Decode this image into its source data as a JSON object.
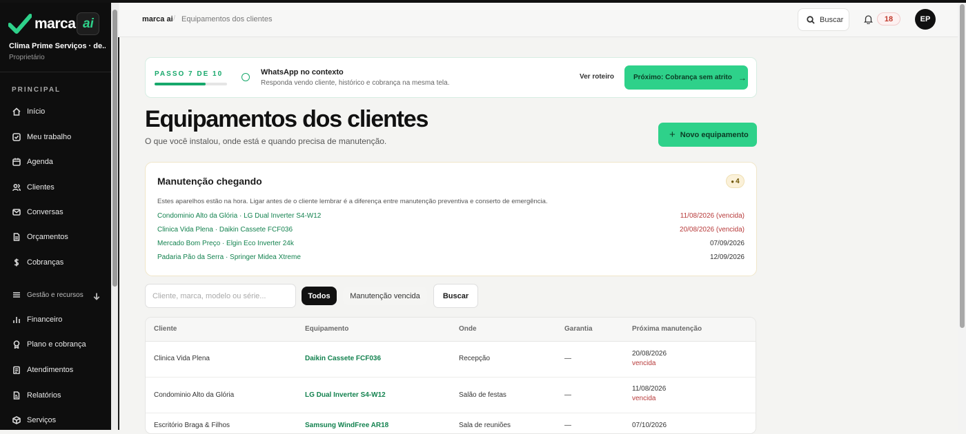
{
  "brand": {
    "name": "marca",
    "mark": "ai"
  },
  "org": {
    "name": "Clima Prime Serviços · de...",
    "role": "Proprietário"
  },
  "sidebar": {
    "section": "PRINCIPAL",
    "items": [
      {
        "label": "Início",
        "icon": "home-icon"
      },
      {
        "label": "Meu trabalho",
        "icon": "check-square-icon"
      },
      {
        "label": "Agenda",
        "icon": "calendar-icon"
      },
      {
        "label": "Clientes",
        "icon": "users-icon"
      },
      {
        "label": "Conversas",
        "icon": "message-icon"
      },
      {
        "label": "Orçamentos",
        "icon": "document-icon"
      },
      {
        "label": "Cobranças",
        "icon": "dollar-icon"
      }
    ],
    "group": "Gestão e recursos",
    "group_items": [
      {
        "label": "Financeiro",
        "icon": "bar-chart-icon"
      },
      {
        "label": "Plano e cobrança",
        "icon": "award-icon"
      },
      {
        "label": "Atendimentos",
        "icon": "clipboard-icon"
      },
      {
        "label": "Relatórios",
        "icon": "report-icon"
      },
      {
        "label": "Serviços",
        "icon": "box-icon"
      }
    ]
  },
  "topbar": {
    "breadcrumb_root": "marca ai",
    "breadcrumb_sep": "/",
    "breadcrumb_current": "Equipamentos dos clientes",
    "search_label": "Buscar",
    "notifications": "18",
    "avatar": "EP"
  },
  "step": {
    "label": "PASSO 7 DE 10",
    "progress": 0.7,
    "title": "WhatsApp no contexto",
    "description": "Responda vendo cliente, histórico e cobrança na mesma tela.",
    "link": "Ver roteiro",
    "next": "Próximo: Cobrança sem atrito",
    "next_arrow": "→"
  },
  "page": {
    "title": "Equipamentos dos clientes",
    "subtitle": "O que você instalou, onde está e quando precisa de manutenção.",
    "new_button": "Novo equipamento"
  },
  "maintenance": {
    "title": "Manutenção chegando",
    "badge": "4",
    "description": "Estes aparelhos estão na hora. Ligar antes de o cliente lembrar é a diferença entre manutenção preventiva e conserto de emergência.",
    "items": [
      {
        "name": "Condominio Alto da Glória · LG Dual Inverter S4-W12",
        "date": "11/08/2026 (vencida)",
        "overdue": true
      },
      {
        "name": "Clinica Vida Plena · Daikin Cassete FCF036",
        "date": "20/08/2026 (vencida)",
        "overdue": true
      },
      {
        "name": "Mercado Bom Preço · Elgin Eco Inverter 24k",
        "date": "07/09/2026",
        "overdue": false
      },
      {
        "name": "Padaria Pão da Serra · Springer Midea Xtreme",
        "date": "12/09/2026",
        "overdue": false
      }
    ]
  },
  "filters": {
    "placeholder": "Cliente, marca, modelo ou série...",
    "chip_all": "Todos",
    "chip_overdue": "Manutenção vencida",
    "search_button": "Buscar"
  },
  "table": {
    "headers": [
      "Cliente",
      "Equipamento",
      "Onde",
      "Garantia",
      "Próxima manutenção"
    ],
    "rows": [
      {
        "client": "Clinica Vida Plena",
        "equipment": "Daikin Cassete FCF036",
        "where": "Recepção",
        "warranty": "—",
        "next": "20/08/2026",
        "status": "vencida"
      },
      {
        "client": "Condominio Alto da Glória",
        "equipment": "LG Dual Inverter S4-W12",
        "where": "Salão de festas",
        "warranty": "—",
        "next": "11/08/2026",
        "status": "vencida"
      },
      {
        "client": "Escritório Braga & Filhos",
        "equipment": "Samsung WindFree AR18",
        "where": "Sala de reuniões",
        "warranty": "—",
        "next": "07/10/2026",
        "status": ""
      }
    ]
  },
  "colors": {
    "accent": "#2ed18a",
    "accent_text": "#13824f",
    "overdue": "#b73a3a",
    "sidebar": "#0e0e0e"
  }
}
